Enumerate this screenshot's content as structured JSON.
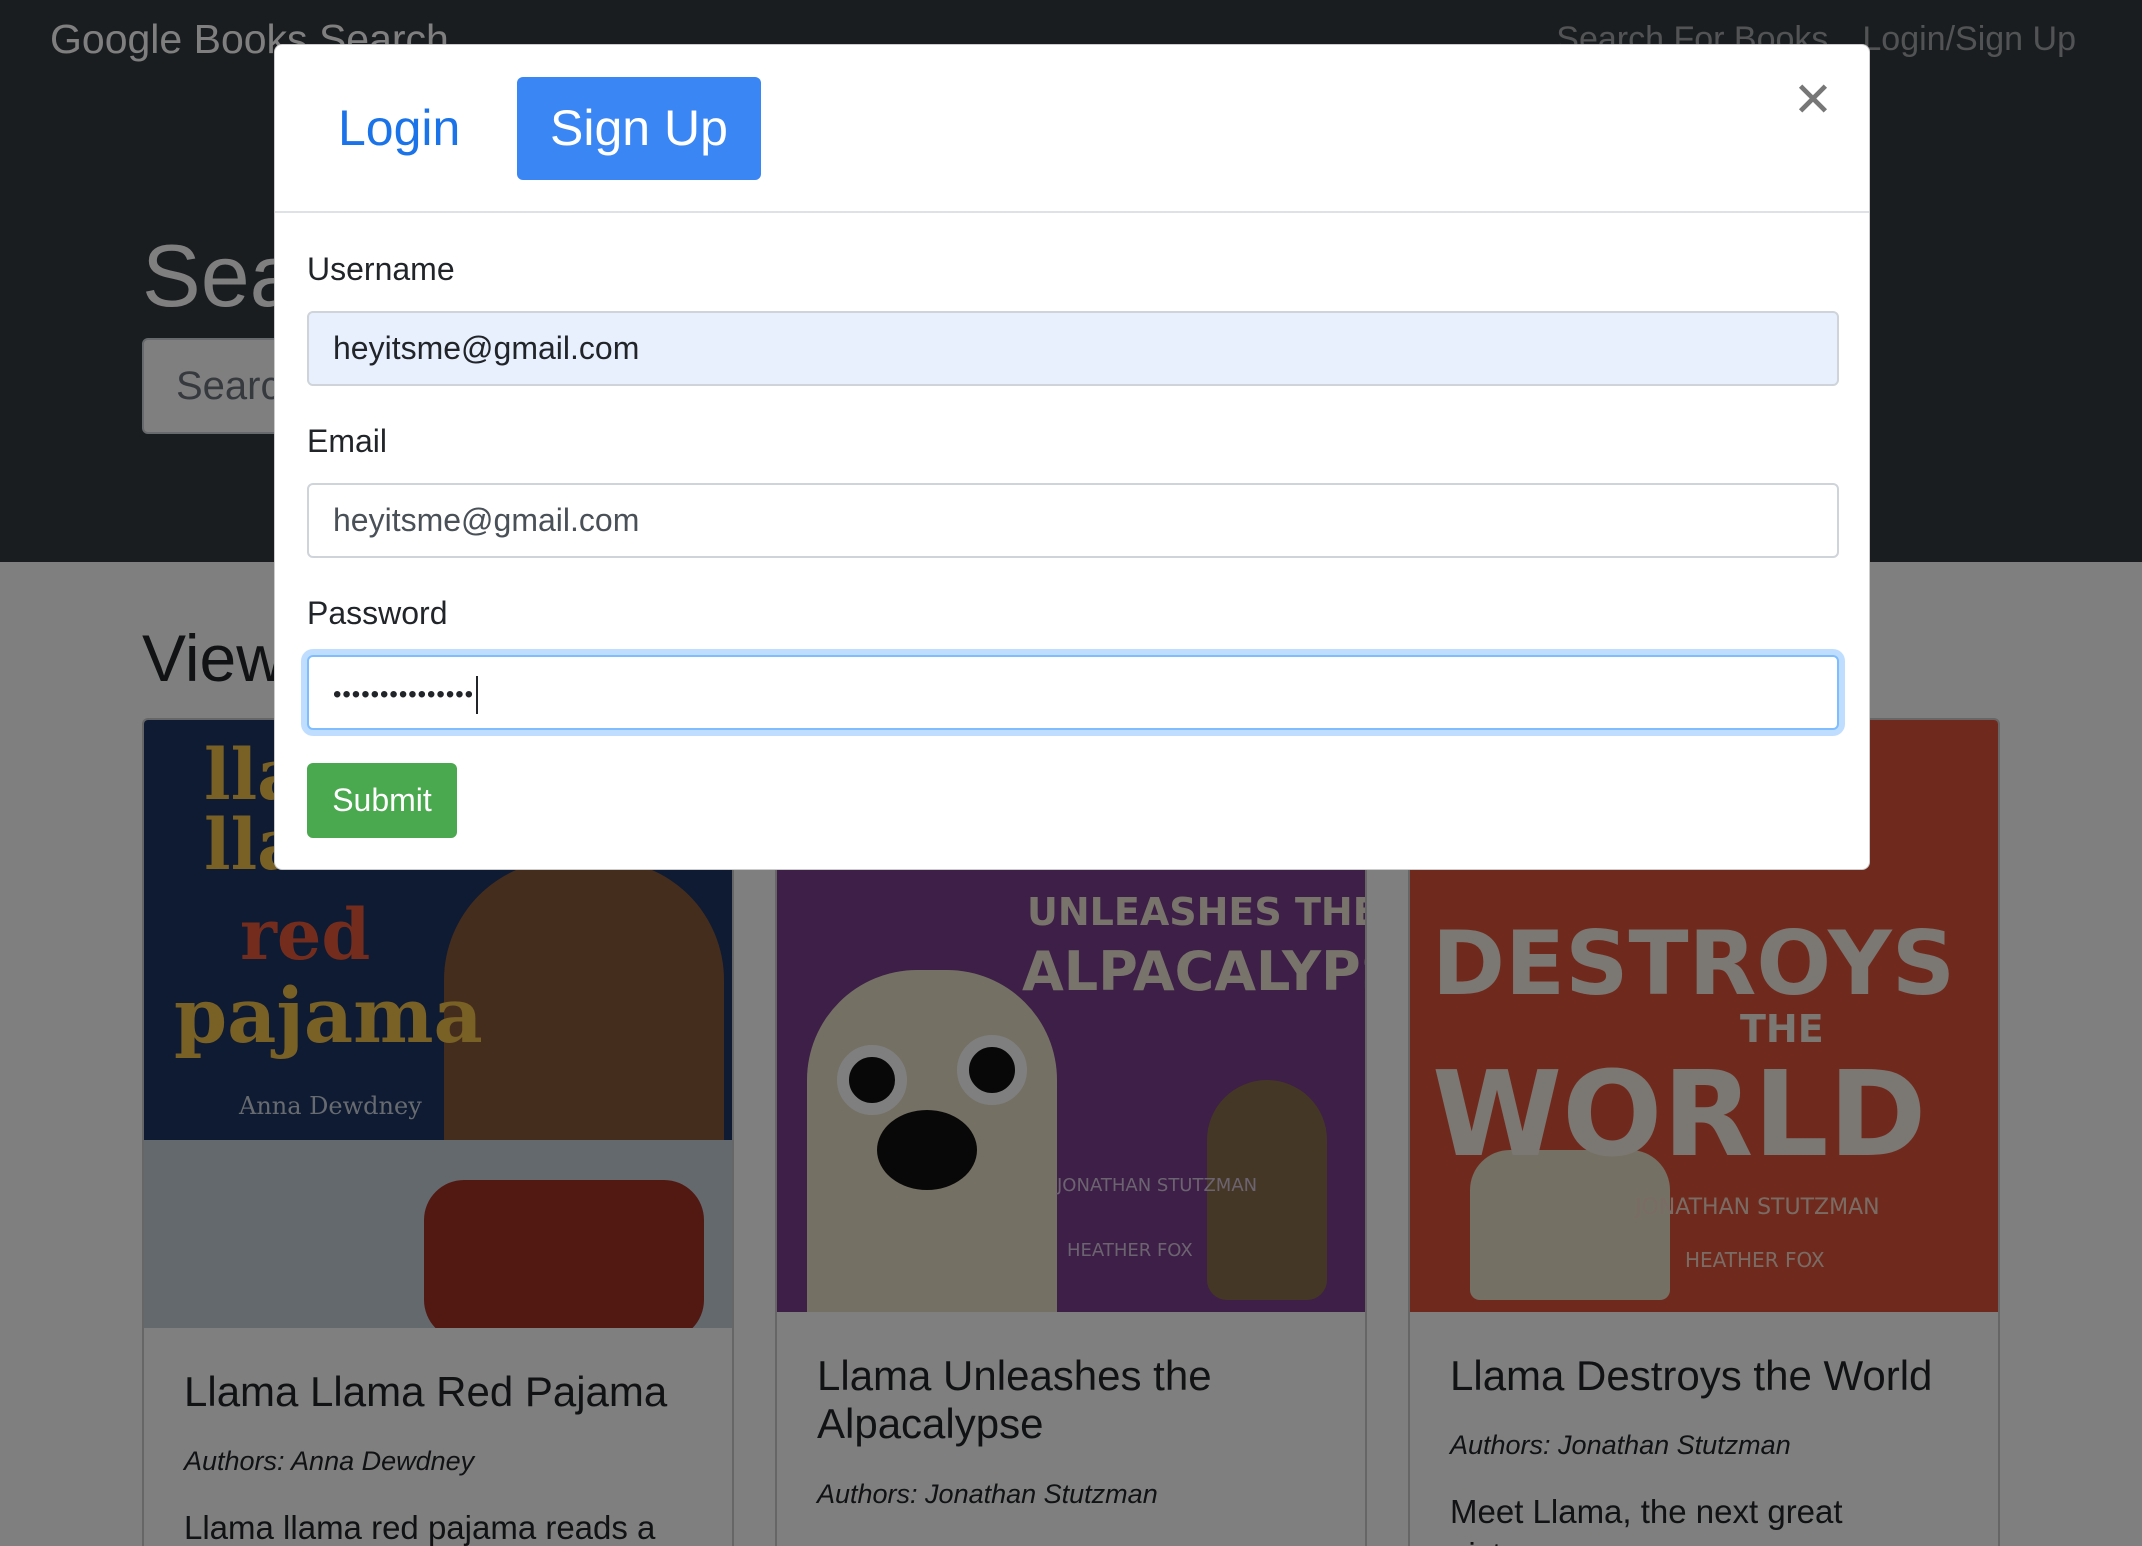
{
  "navbar": {
    "brand": "Google Books Search",
    "links": [
      "Search For Books",
      "Login/Sign Up"
    ]
  },
  "hero": {
    "title": "Search For Books",
    "search_placeholder": "Search"
  },
  "results": {
    "title": "View Results",
    "cards": [
      {
        "cover_lines": [
          "llama",
          "llama",
          "red",
          "pajama"
        ],
        "cover_author": "Anna Dewdney",
        "title": "Llama Llama Red Pajama",
        "authors": "Authors: Anna Dewdney",
        "description": "Llama llama red pajama reads a"
      },
      {
        "cover_lines": [
          "UNLEASHES THE",
          "ALPACALYPSE"
        ],
        "cover_author": "JONATHAN STUTZMAN",
        "cover_illustrator": "HEATHER FOX",
        "title": "Llama Unleashes the Alpacalypse",
        "authors": "Authors: Jonathan Stutzman",
        "description": ""
      },
      {
        "cover_lines": [
          "DESTROYS",
          "THE",
          "WORLD"
        ],
        "cover_author": "JONATHAN STUTZMAN",
        "cover_illustrator": "HEATHER FOX",
        "title": "Llama Destroys the World",
        "authors": "Authors: Jonathan Stutzman",
        "description": "Meet Llama, the next great picture-"
      }
    ]
  },
  "modal": {
    "tabs": [
      "Login",
      "Sign Up"
    ],
    "active_tab": "Sign Up",
    "close_icon": "close-icon",
    "fields": {
      "username": {
        "label": "Username",
        "value": "heyitsme@gmail.com"
      },
      "email": {
        "label": "Email",
        "value": "heyitsme@gmail.com"
      },
      "password": {
        "label": "Password",
        "masked": "•••••••••••••••"
      }
    },
    "submit_label": "Submit"
  },
  "colors": {
    "navbar_bg": "#343a40",
    "tab_active_bg": "#3a86f4",
    "tab_link": "#1a73e8",
    "submit_bg": "#4aa84f",
    "autofill_bg": "#e8f0fe",
    "focus_border": "#80bdff"
  }
}
